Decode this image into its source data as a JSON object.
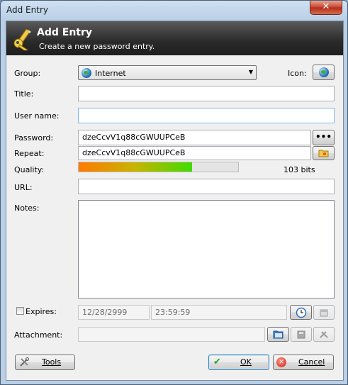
{
  "window": {
    "title": "Add Entry",
    "close_glyph": "✕"
  },
  "banner": {
    "title": "Add Entry",
    "subtitle": "Create a new password entry."
  },
  "form": {
    "group_label": "Group:",
    "group_value": "Internet",
    "icon_label": "Icon:",
    "title_label": "Title:",
    "title_value": "",
    "username_label": "User name:",
    "username_value": "",
    "password_label": "Password:",
    "password_value": "dzeCcvV1q88cGWUUPCeB",
    "show_password_glyph": "•••",
    "repeat_label": "Repeat:",
    "repeat_value": "dzeCcvV1q88cGWUUPCeB",
    "quality_label": "Quality:",
    "quality_bits": "103 bits",
    "quality_fraction": 0.71,
    "url_label": "URL:",
    "url_value": "",
    "notes_label": "Notes:",
    "notes_value": "",
    "expires_label": "Expires:",
    "expires_checked": false,
    "expires_date": "12/28/2999",
    "expires_time": "23:59:59",
    "attachment_label": "Attachment:"
  },
  "buttons": {
    "tools": "Tools",
    "ok": "OK",
    "cancel": "Cancel"
  },
  "colors": {
    "banner_bg": "#2a2a2a",
    "quality_start": "#ff7a00",
    "quality_end": "#3fdc00",
    "close_button": "#c7432e"
  }
}
